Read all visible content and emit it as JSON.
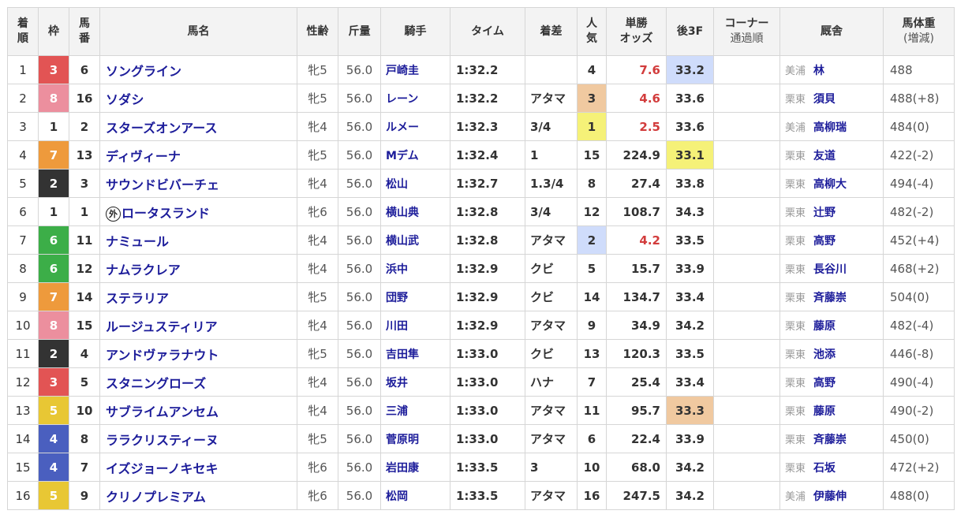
{
  "headers": {
    "rank": [
      "着",
      "順"
    ],
    "waku": "枠",
    "umaban": [
      "馬",
      "番"
    ],
    "horse": "馬名",
    "sexage": "性齢",
    "kinryo": "斤量",
    "jockey": "騎手",
    "time": "タイム",
    "margin": "着差",
    "popularity": [
      "人",
      "気"
    ],
    "odds": [
      "単勝",
      "オッズ"
    ],
    "last3f": "後3F",
    "corner": [
      "コーナー",
      "通過順"
    ],
    "trainer": "厩舎",
    "weight": [
      "馬体重",
      "(増減)"
    ]
  },
  "colors": {
    "waku": {
      "1": {
        "bg": "#ffffff",
        "fg": "#333333"
      },
      "2": {
        "bg": "#333333",
        "fg": "#ffffff"
      },
      "3": {
        "bg": "#e25454",
        "fg": "#ffffff"
      },
      "4": {
        "bg": "#4a5fbf",
        "fg": "#ffffff"
      },
      "5": {
        "bg": "#e8c734",
        "fg": "#ffffff"
      },
      "6": {
        "bg": "#3cae48",
        "fg": "#ffffff"
      },
      "7": {
        "bg": "#ee9a3c",
        "fg": "#ffffff"
      },
      "8": {
        "bg": "#ec8f9e",
        "fg": "#ffffff"
      }
    },
    "rank1_highlight": "#f5f178",
    "rank2_highlight": "#cfdcfb",
    "rank3_highlight": "#f0c9a0"
  },
  "rows": [
    {
      "rank": "1",
      "waku": "3",
      "umaban": "6",
      "foreign_mark": "",
      "horse": "ソングライン",
      "sexage": "牝5",
      "kinryo": "56.0",
      "jockey": "戸崎圭",
      "time": "1:32.2",
      "margin": "",
      "popularity": "4",
      "pop_hl": "",
      "odds": "7.6",
      "odds_fav": true,
      "last3f": "33.2",
      "last3f_hl": "2",
      "corner": "",
      "loc": "美浦",
      "trainer": "林",
      "weight": "488"
    },
    {
      "rank": "2",
      "waku": "8",
      "umaban": "16",
      "foreign_mark": "",
      "horse": "ソダシ",
      "sexage": "牝5",
      "kinryo": "56.0",
      "jockey": "レーン",
      "time": "1:32.2",
      "margin": "アタマ",
      "popularity": "3",
      "pop_hl": "3",
      "odds": "4.6",
      "odds_fav": true,
      "last3f": "33.6",
      "last3f_hl": "",
      "corner": "",
      "loc": "栗東",
      "trainer": "須貝",
      "weight": "488(+8)"
    },
    {
      "rank": "3",
      "waku": "1",
      "umaban": "2",
      "foreign_mark": "",
      "horse": "スターズオンアース",
      "sexage": "牝4",
      "kinryo": "56.0",
      "jockey": "ルメー",
      "time": "1:32.3",
      "margin": "3/4",
      "popularity": "1",
      "pop_hl": "1",
      "odds": "2.5",
      "odds_fav": true,
      "last3f": "33.6",
      "last3f_hl": "",
      "corner": "",
      "loc": "美浦",
      "trainer": "高柳瑞",
      "weight": "484(0)"
    },
    {
      "rank": "4",
      "waku": "7",
      "umaban": "13",
      "foreign_mark": "",
      "horse": "ディヴィーナ",
      "sexage": "牝5",
      "kinryo": "56.0",
      "jockey": "Mデム",
      "time": "1:32.4",
      "margin": "1",
      "popularity": "15",
      "pop_hl": "",
      "odds": "224.9",
      "odds_fav": false,
      "last3f": "33.1",
      "last3f_hl": "1",
      "corner": "",
      "loc": "栗東",
      "trainer": "友道",
      "weight": "422(-2)"
    },
    {
      "rank": "5",
      "waku": "2",
      "umaban": "3",
      "foreign_mark": "",
      "horse": "サウンドビバーチェ",
      "sexage": "牝4",
      "kinryo": "56.0",
      "jockey": "松山",
      "time": "1:32.7",
      "margin": "1.3/4",
      "popularity": "8",
      "pop_hl": "",
      "odds": "27.4",
      "odds_fav": false,
      "last3f": "33.8",
      "last3f_hl": "",
      "corner": "",
      "loc": "栗東",
      "trainer": "高柳大",
      "weight": "494(-4)"
    },
    {
      "rank": "6",
      "waku": "1",
      "umaban": "1",
      "foreign_mark": "外",
      "horse": "ロータスランド",
      "sexage": "牝6",
      "kinryo": "56.0",
      "jockey": "横山典",
      "time": "1:32.8",
      "margin": "3/4",
      "popularity": "12",
      "pop_hl": "",
      "odds": "108.7",
      "odds_fav": false,
      "last3f": "34.3",
      "last3f_hl": "",
      "corner": "",
      "loc": "栗東",
      "trainer": "辻野",
      "weight": "482(-2)"
    },
    {
      "rank": "7",
      "waku": "6",
      "umaban": "11",
      "foreign_mark": "",
      "horse": "ナミュール",
      "sexage": "牝4",
      "kinryo": "56.0",
      "jockey": "横山武",
      "time": "1:32.8",
      "margin": "アタマ",
      "popularity": "2",
      "pop_hl": "2",
      "odds": "4.2",
      "odds_fav": true,
      "last3f": "33.5",
      "last3f_hl": "",
      "corner": "",
      "loc": "栗東",
      "trainer": "高野",
      "weight": "452(+4)"
    },
    {
      "rank": "8",
      "waku": "6",
      "umaban": "12",
      "foreign_mark": "",
      "horse": "ナムラクレア",
      "sexage": "牝4",
      "kinryo": "56.0",
      "jockey": "浜中",
      "time": "1:32.9",
      "margin": "クビ",
      "popularity": "5",
      "pop_hl": "",
      "odds": "15.7",
      "odds_fav": false,
      "last3f": "33.9",
      "last3f_hl": "",
      "corner": "",
      "loc": "栗東",
      "trainer": "長谷川",
      "weight": "468(+2)"
    },
    {
      "rank": "9",
      "waku": "7",
      "umaban": "14",
      "foreign_mark": "",
      "horse": "ステラリア",
      "sexage": "牝5",
      "kinryo": "56.0",
      "jockey": "団野",
      "time": "1:32.9",
      "margin": "クビ",
      "popularity": "14",
      "pop_hl": "",
      "odds": "134.7",
      "odds_fav": false,
      "last3f": "33.4",
      "last3f_hl": "",
      "corner": "",
      "loc": "栗東",
      "trainer": "斉藤崇",
      "weight": "504(0)"
    },
    {
      "rank": "10",
      "waku": "8",
      "umaban": "15",
      "foreign_mark": "",
      "horse": "ルージュスティリア",
      "sexage": "牝4",
      "kinryo": "56.0",
      "jockey": "川田",
      "time": "1:32.9",
      "margin": "アタマ",
      "popularity": "9",
      "pop_hl": "",
      "odds": "34.9",
      "odds_fav": false,
      "last3f": "34.2",
      "last3f_hl": "",
      "corner": "",
      "loc": "栗東",
      "trainer": "藤原",
      "weight": "482(-4)"
    },
    {
      "rank": "11",
      "waku": "2",
      "umaban": "4",
      "foreign_mark": "",
      "horse": "アンドヴァラナウト",
      "sexage": "牝5",
      "kinryo": "56.0",
      "jockey": "吉田隼",
      "time": "1:33.0",
      "margin": "クビ",
      "popularity": "13",
      "pop_hl": "",
      "odds": "120.3",
      "odds_fav": false,
      "last3f": "33.5",
      "last3f_hl": "",
      "corner": "",
      "loc": "栗東",
      "trainer": "池添",
      "weight": "446(-8)"
    },
    {
      "rank": "12",
      "waku": "3",
      "umaban": "5",
      "foreign_mark": "",
      "horse": "スタニングローズ",
      "sexage": "牝4",
      "kinryo": "56.0",
      "jockey": "坂井",
      "time": "1:33.0",
      "margin": "ハナ",
      "popularity": "7",
      "pop_hl": "",
      "odds": "25.4",
      "odds_fav": false,
      "last3f": "33.4",
      "last3f_hl": "",
      "corner": "",
      "loc": "栗東",
      "trainer": "高野",
      "weight": "490(-4)"
    },
    {
      "rank": "13",
      "waku": "5",
      "umaban": "10",
      "foreign_mark": "",
      "horse": "サブライムアンセム",
      "sexage": "牝4",
      "kinryo": "56.0",
      "jockey": "三浦",
      "time": "1:33.0",
      "margin": "アタマ",
      "popularity": "11",
      "pop_hl": "",
      "odds": "95.7",
      "odds_fav": false,
      "last3f": "33.3",
      "last3f_hl": "3",
      "corner": "",
      "loc": "栗東",
      "trainer": "藤原",
      "weight": "490(-2)"
    },
    {
      "rank": "14",
      "waku": "4",
      "umaban": "8",
      "foreign_mark": "",
      "horse": "ララクリスティーヌ",
      "sexage": "牝5",
      "kinryo": "56.0",
      "jockey": "菅原明",
      "time": "1:33.0",
      "margin": "アタマ",
      "popularity": "6",
      "pop_hl": "",
      "odds": "22.4",
      "odds_fav": false,
      "last3f": "33.9",
      "last3f_hl": "",
      "corner": "",
      "loc": "栗東",
      "trainer": "斉藤崇",
      "weight": "450(0)"
    },
    {
      "rank": "15",
      "waku": "4",
      "umaban": "7",
      "foreign_mark": "",
      "horse": "イズジョーノキセキ",
      "sexage": "牝6",
      "kinryo": "56.0",
      "jockey": "岩田康",
      "time": "1:33.5",
      "margin": "3",
      "popularity": "10",
      "pop_hl": "",
      "odds": "68.0",
      "odds_fav": false,
      "last3f": "34.2",
      "last3f_hl": "",
      "corner": "",
      "loc": "栗東",
      "trainer": "石坂",
      "weight": "472(+2)"
    },
    {
      "rank": "16",
      "waku": "5",
      "umaban": "9",
      "foreign_mark": "",
      "horse": "クリノプレミアム",
      "sexage": "牝6",
      "kinryo": "56.0",
      "jockey": "松岡",
      "time": "1:33.5",
      "margin": "アタマ",
      "popularity": "16",
      "pop_hl": "",
      "odds": "247.5",
      "odds_fav": false,
      "last3f": "34.2",
      "last3f_hl": "",
      "corner": "",
      "loc": "美浦",
      "trainer": "伊藤伸",
      "weight": "488(0)"
    }
  ]
}
